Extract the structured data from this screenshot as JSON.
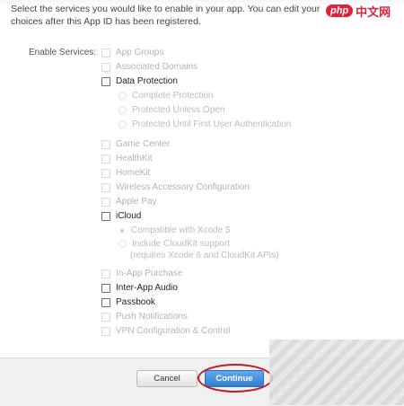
{
  "header": {
    "intro_text": "Select the services you would like to enable in your app. You can edit your choices after this App ID has been registered.",
    "watermark_php": "php",
    "watermark_cn": "中文网"
  },
  "services": {
    "label": "Enable Services:",
    "items": [
      {
        "label": "App Groups"
      },
      {
        "label": "Associated Domains"
      },
      {
        "label": "Data Protection"
      },
      {
        "label": "Complete Protection"
      },
      {
        "label": "Protected Unless Open"
      },
      {
        "label": "Protected Until First User Authentication"
      },
      {
        "label": "Game Center"
      },
      {
        "label": "HealthKit"
      },
      {
        "label": "HomeKit"
      },
      {
        "label": "Wireless Accessory Configuration"
      },
      {
        "label": "Apple Pay"
      },
      {
        "label": "iCloud"
      },
      {
        "label": "Compatible with Xcode 5"
      },
      {
        "label": "Include CloudKit support"
      },
      {
        "label": "(requires Xcode 6 and CloudKit APIs)"
      },
      {
        "label": "In-App Purchase"
      },
      {
        "label": "Inter-App Audio"
      },
      {
        "label": "Passbook"
      },
      {
        "label": "Push Notifications"
      },
      {
        "label": "VPN Configuration & Control"
      }
    ]
  },
  "footer": {
    "cancel_label": "Cancel",
    "continue_label": "Continue"
  }
}
